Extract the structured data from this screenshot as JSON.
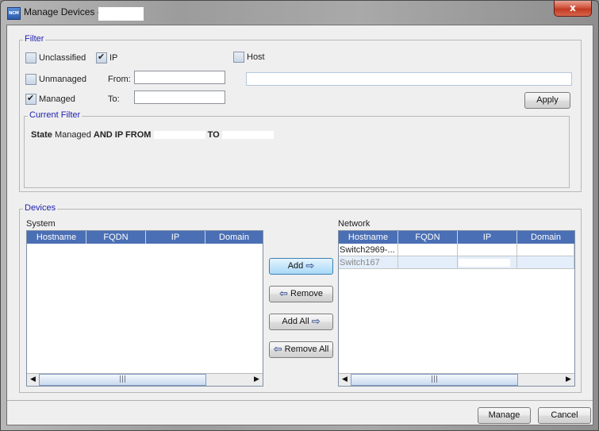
{
  "window": {
    "title": "Manage Devices -",
    "app_icon_text": "NCM",
    "close_label": "x"
  },
  "filter": {
    "group_title": "Filter",
    "unclassified": {
      "label": "Unclassified",
      "checked": false
    },
    "ip": {
      "label": "IP",
      "checked": true
    },
    "host": {
      "label": "Host",
      "checked": false
    },
    "unmanaged": {
      "label": "Unmanaged",
      "checked": false
    },
    "managed": {
      "label": "Managed",
      "checked": true
    },
    "from_label": "From:",
    "to_label": "To:",
    "from_value": "",
    "to_value": "",
    "host_value": "",
    "apply_label": "Apply"
  },
  "current_filter": {
    "group_title": "Current Filter",
    "parts": [
      "State",
      "Managed",
      "AND IP FROM",
      "TO"
    ]
  },
  "devices": {
    "group_title": "Devices",
    "system": {
      "label": "System",
      "columns": [
        "Hostname",
        "FQDN",
        "IP",
        "Domain"
      ],
      "rows": []
    },
    "network": {
      "label": "Network",
      "columns": [
        "Hostname",
        "FQDN",
        "IP",
        "Domain"
      ],
      "rows": [
        {
          "hostname": "Switch2969-...",
          "fqdn": "",
          "ip": "",
          "domain": "",
          "selected": false
        },
        {
          "hostname": "Switch167",
          "fqdn": "",
          "ip": "",
          "domain": "",
          "selected": true
        }
      ]
    },
    "buttons": {
      "add": "Add",
      "remove": "Remove",
      "add_all": "Add All",
      "remove_all": "Remove All"
    },
    "scroll_icons": {
      "left": "◀",
      "right": "▶",
      "grip": "|||"
    }
  },
  "footer": {
    "manage_label": "Manage",
    "cancel_label": "Cancel"
  },
  "icons": {
    "arrow_right": "⇨",
    "arrow_left": "⇦"
  }
}
